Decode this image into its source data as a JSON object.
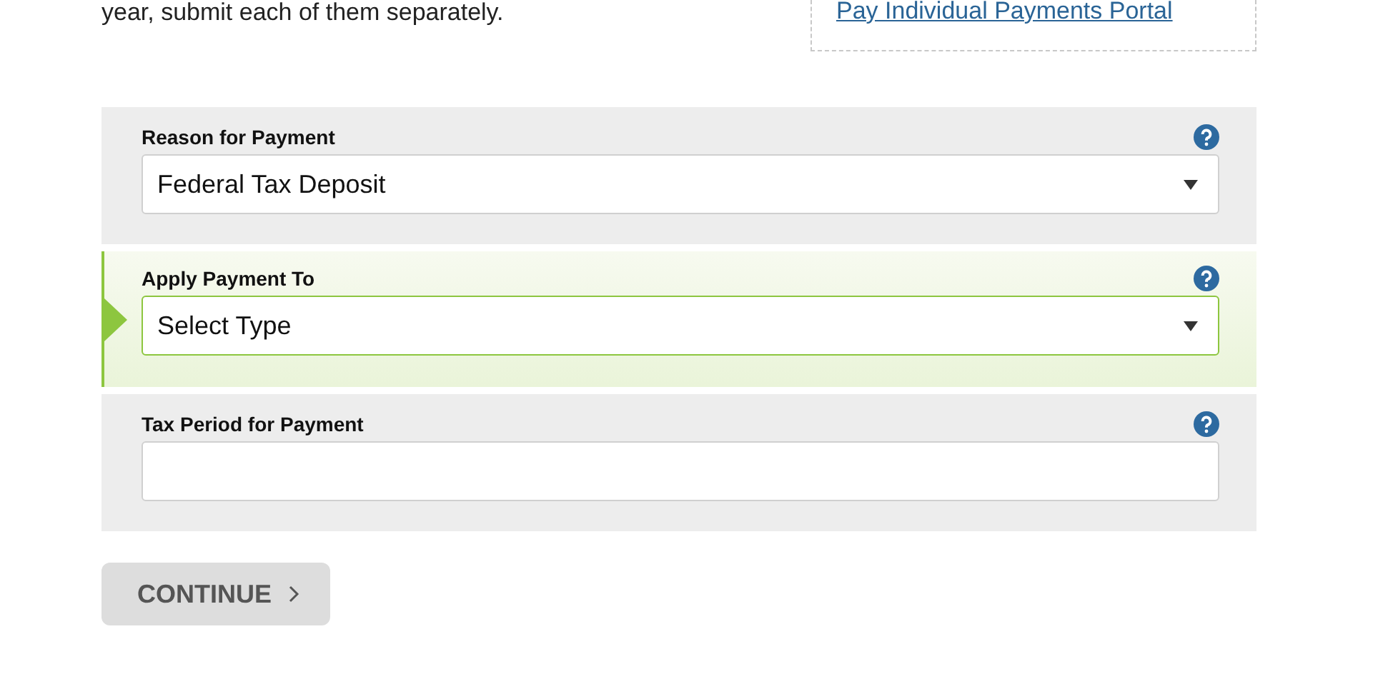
{
  "intro_text": "year, submit each of them separately.",
  "portal_link": "Pay Individual Payments Portal",
  "fields": [
    {
      "label": "Reason for Payment",
      "kind": "select",
      "value": "Federal Tax Deposit",
      "active": false
    },
    {
      "label": "Apply Payment To",
      "kind": "select",
      "value": "Select Type",
      "active": true
    },
    {
      "label": "Tax Period for Payment",
      "kind": "text",
      "active": false
    }
  ],
  "continue_button": "CONTINUE"
}
